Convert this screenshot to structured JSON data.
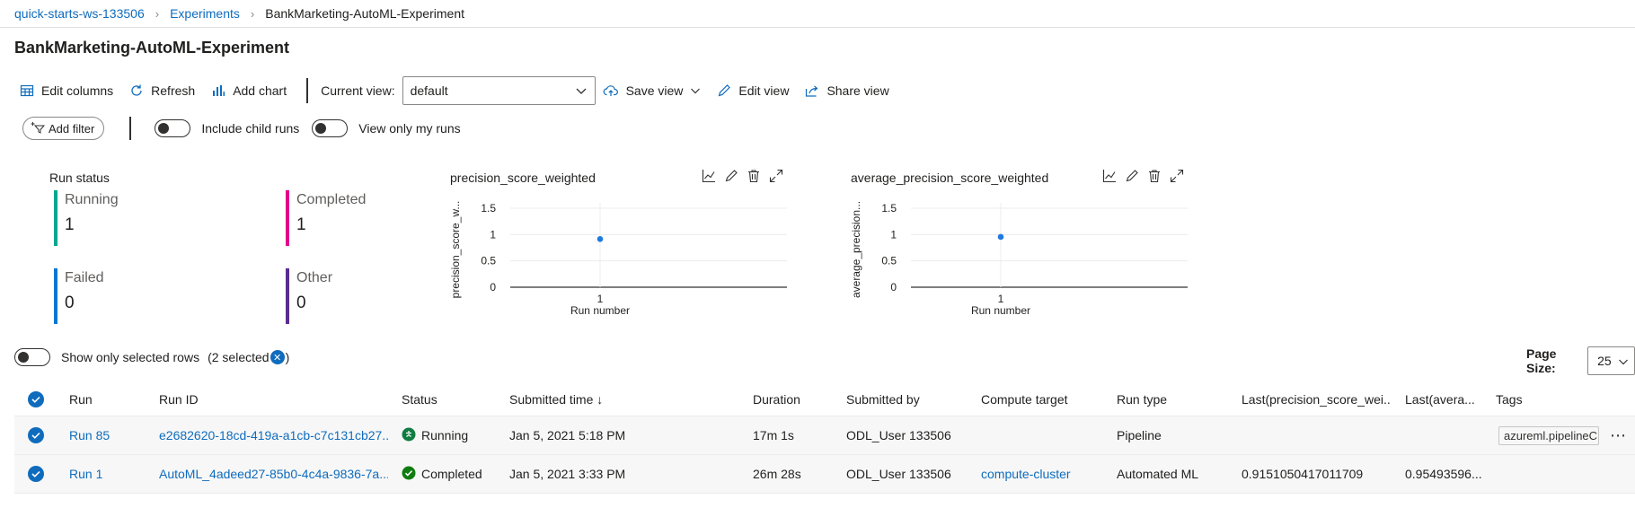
{
  "breadcrumb": {
    "workspace": "quick-starts-ws-133506",
    "experiments": "Experiments",
    "current": "BankMarketing-AutoML-Experiment"
  },
  "page_title": "BankMarketing-AutoML-Experiment",
  "toolbar": {
    "edit_columns": "Edit columns",
    "refresh": "Refresh",
    "add_chart": "Add chart",
    "current_view_label": "Current view:",
    "current_view_value": "default",
    "save_view": "Save view",
    "edit_view": "Edit view",
    "share_view": "Share view"
  },
  "filters": {
    "add_filter": "Add filter",
    "include_child_runs": "Include child runs",
    "view_only_my_runs": "View only my runs"
  },
  "run_status": {
    "title": "Run status",
    "items": [
      {
        "label": "Running",
        "count": "1",
        "color": "#00a88f"
      },
      {
        "label": "Completed",
        "count": "1",
        "color": "#e3008c"
      },
      {
        "label": "Failed",
        "count": "0",
        "color": "#0078d4"
      },
      {
        "label": "Other",
        "count": "0",
        "color": "#5c2d91"
      }
    ]
  },
  "charts": {
    "chart1_title": "precision_score_weighted",
    "chart1_ylabel": "precision_score_w...",
    "chart2_title": "average_precision_score_weighted",
    "chart2_ylabel": "average_precision...",
    "xlabel": "Run number",
    "point_color": "#1f7ae0"
  },
  "chart_data": [
    {
      "type": "scatter",
      "title": "precision_score_weighted",
      "xlabel": "Run number",
      "ylabel": "precision_score_w...",
      "x": [
        1
      ],
      "y": [
        0.915
      ],
      "xticks": [
        "1"
      ],
      "yticks": [
        "0",
        "0.5",
        "1",
        "1.5"
      ],
      "ylim": [
        0,
        1.5
      ]
    },
    {
      "type": "scatter",
      "title": "average_precision_score_weighted",
      "xlabel": "Run number",
      "ylabel": "average_precision...",
      "x": [
        1
      ],
      "y": [
        0.955
      ],
      "xticks": [
        "1"
      ],
      "yticks": [
        "0",
        "0.5",
        "1",
        "1.5"
      ],
      "ylim": [
        0,
        1.5
      ]
    }
  ],
  "selection": {
    "show_only_selected": "Show only selected rows",
    "selected_text": "(2 selected",
    "close_paren": ")"
  },
  "page_size": {
    "label": "Page Size:",
    "value": "25"
  },
  "table": {
    "headers": {
      "run": "Run",
      "run_id": "Run ID",
      "status": "Status",
      "submitted_time": "Submitted time ↓",
      "duration": "Duration",
      "submitted_by": "Submitted by",
      "compute_target": "Compute target",
      "run_type": "Run type",
      "last_precision": "Last(precision_score_wei...",
      "last_average": "Last(avera...",
      "tags": "Tags"
    },
    "rows": [
      {
        "run": "Run 85",
        "run_id": "e2682620-18cd-419a-a1cb-c7c131cb27...",
        "status": "Running",
        "submitted_time": "Jan 5, 2021 5:18 PM",
        "duration": "17m 1s",
        "submitted_by": "ODL_User 133506",
        "compute_target": "",
        "run_type": "Pipeline",
        "last_precision": "",
        "last_average": "",
        "tag": "azureml.pipelineC"
      },
      {
        "run": "Run 1",
        "run_id": "AutoML_4adeed27-85b0-4c4a-9836-7a...",
        "status": "Completed",
        "submitted_time": "Jan 5, 2021 3:33 PM",
        "duration": "26m 28s",
        "submitted_by": "ODL_User 133506",
        "compute_target": "compute-cluster",
        "run_type": "Automated ML",
        "last_precision": "0.9151050417011709",
        "last_average": "0.95493596...",
        "tag": ""
      }
    ]
  }
}
